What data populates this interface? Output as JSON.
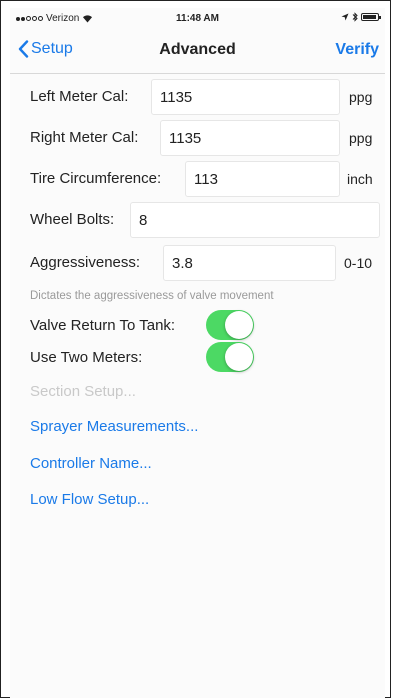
{
  "status_bar": {
    "carrier": "Verizon",
    "time": "11:48 AM"
  },
  "nav": {
    "back_label": "Setup",
    "title": "Advanced",
    "action_label": "Verify"
  },
  "fields": {
    "left_meter_cal": {
      "label": "Left Meter Cal:",
      "value": "1135",
      "unit": "ppg"
    },
    "right_meter_cal": {
      "label": "Right Meter Cal:",
      "value": "1135",
      "unit": "ppg"
    },
    "tire_circumference": {
      "label": "Tire Circumference:",
      "value": "113",
      "unit": "inch"
    },
    "wheel_bolts": {
      "label": "Wheel Bolts:",
      "value": "8"
    },
    "aggressiveness": {
      "label": "Aggressiveness:",
      "value": "3.8",
      "unit": "0-10"
    }
  },
  "aggressiveness_hint": "Dictates the aggressiveness of valve movement",
  "switches": {
    "valve_return": {
      "label": "Valve Return To Tank:",
      "on": true
    },
    "two_meters": {
      "label": "Use Two Meters:",
      "on": true
    }
  },
  "links": {
    "section_setup": "Section Setup...",
    "sprayer_measurements": "Sprayer Measurements...",
    "controller_name": "Controller Name...",
    "low_flow_setup": "Low Flow Setup..."
  },
  "colors": {
    "accent": "#1a7ae8",
    "toggle_on": "#4cd964",
    "disabled_text": "#c9c9c9"
  },
  "icons": [
    "signal-dots-icon",
    "wifi-icon",
    "location-icon",
    "bluetooth-icon",
    "battery-icon",
    "chevron-left-icon"
  ]
}
